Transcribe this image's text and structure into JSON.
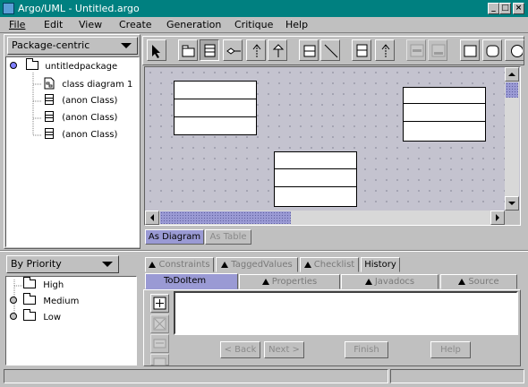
{
  "window": {
    "title": "Argo/UML - Untitled.argo",
    "minimize_glyph": "_",
    "maximize_glyph": "□",
    "close_glyph": "×"
  },
  "menubar": {
    "items": [
      "File",
      "Edit",
      "View",
      "Create",
      "Generation",
      "Critique",
      "Help"
    ]
  },
  "nav_pane": {
    "perspective": "Package-centric",
    "tree": [
      {
        "label": "untitledpackage",
        "icon": "package-icon"
      },
      {
        "label": "class diagram 1",
        "icon": "diagram-icon"
      },
      {
        "label": "(anon Class)",
        "icon": "class-icon"
      },
      {
        "label": "(anon Class)",
        "icon": "class-icon"
      },
      {
        "label": "(anon Class)",
        "icon": "class-icon"
      }
    ]
  },
  "toolbar": {
    "tools": [
      "select-tool",
      "package-tool",
      "class-tool",
      "association-tool",
      "dependency-tool",
      "generalization-tool",
      "interface-tool",
      "realization-tool",
      "class-tool-2",
      "dependency-tool-2",
      "attribute-tool",
      "operation-tool",
      "rectangle-tool",
      "rounded-rectangle-tool",
      "circle-tool"
    ]
  },
  "editor": {
    "tabs": [
      "As Diagram",
      "As Table"
    ],
    "selected_tab": "As Diagram",
    "class_count": 3
  },
  "todo_pane": {
    "grouping": "By Priority",
    "items": [
      "High",
      "Medium",
      "Low"
    ]
  },
  "details_pane": {
    "top_tabs": [
      "Constraints",
      "TaggedValues",
      "Checklist",
      "History"
    ],
    "bottom_tabs": [
      "ToDoItem",
      "Properties",
      "Javadocs",
      "Source"
    ],
    "selected_tab": "ToDoItem",
    "description": "",
    "wizard_buttons": {
      "back": "< Back",
      "next": "Next >",
      "finish": "Finish",
      "help": "Help"
    }
  },
  "colors": {
    "titlebar": "#008080",
    "selection": "#9a9ad4",
    "canvas": "#c4c3cf"
  }
}
